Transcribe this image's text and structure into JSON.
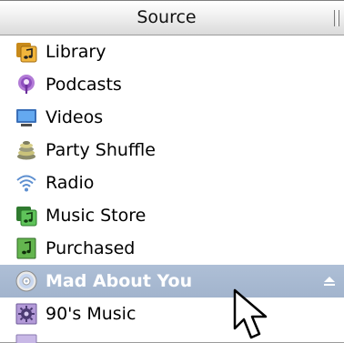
{
  "header": {
    "title": "Source"
  },
  "sources": [
    {
      "label": "Library",
      "icon": "library-icon"
    },
    {
      "label": "Podcasts",
      "icon": "podcast-icon"
    },
    {
      "label": "Videos",
      "icon": "video-monitor-icon"
    },
    {
      "label": "Party Shuffle",
      "icon": "party-shuffle-icon"
    },
    {
      "label": "Radio",
      "icon": "radio-waves-icon"
    },
    {
      "label": "Music Store",
      "icon": "music-store-icon"
    },
    {
      "label": "Purchased",
      "icon": "purchased-playlist-icon"
    },
    {
      "label": "Mad About You",
      "icon": "cd-icon",
      "selected": true,
      "eject": "eject-icon"
    },
    {
      "label": "90's Music",
      "icon": "smart-playlist-gear-icon"
    }
  ],
  "colors": {
    "selection": "#a9bad2",
    "selected_text": "#ffffff"
  },
  "cursor": "arrow-pointer"
}
